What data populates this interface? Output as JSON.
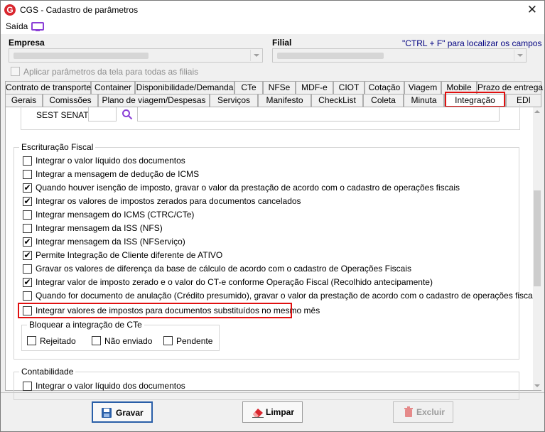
{
  "window": {
    "title": "CGS - Cadastro de parâmetros",
    "logo_letter": "G"
  },
  "menu": {
    "saida": "Saída"
  },
  "header": {
    "empresa_label": "Empresa",
    "filial_label": "Filial",
    "hint": "\"CTRL + F\" para localizar os campos",
    "apply_all": "Aplicar parâmetros da tela para todas as filiais"
  },
  "tabs_row1": [
    "Contrato de transporte",
    "Container",
    "Disponibilidade/Demanda",
    "CTe",
    "NFSe",
    "MDF-e",
    "CIOT",
    "Cotação",
    "Viagem",
    "Mobile",
    "Prazo de entrega"
  ],
  "tabs_row2": [
    "Gerais",
    "Comissões",
    "Plano de viagem/Despesas",
    "Serviços",
    "Manifesto",
    "CheckList",
    "Coleta",
    "Minuta",
    "Integração",
    "EDI"
  ],
  "sest": {
    "label": "SEST SENAT"
  },
  "escrituracao": {
    "title": "Escrituração Fiscal",
    "items": [
      {
        "label": "Integrar o valor líquido dos documentos",
        "checked": false
      },
      {
        "label": "Integrar a mensagem de dedução de ICMS",
        "checked": false
      },
      {
        "label": "Quando houver isenção de imposto, gravar o valor da prestação de acordo com o cadastro de operações fiscais",
        "checked": true
      },
      {
        "label": "Integrar os valores de impostos zerados para documentos cancelados",
        "checked": true
      },
      {
        "label": "Integrar mensagem do ICMS (CTRC/CTe)",
        "checked": false
      },
      {
        "label": "Integrar mensagem da ISS (NFS)",
        "checked": false
      },
      {
        "label": "Integrar mensagem da ISS (NFServiço)",
        "checked": true
      },
      {
        "label": "Permite Integração de Cliente diferente de ATIVO",
        "checked": true
      },
      {
        "label": "Gravar os valores de diferença da base de cálculo de acordo com o cadastro de Operações Fiscais",
        "checked": false
      },
      {
        "label": "Integrar valor de imposto zerado e o valor do CT-e conforme Operação Fiscal (Recolhido antecipamente)",
        "checked": true
      },
      {
        "label": "Quando for documento de anulação (Crédito presumido), gravar o valor da prestação de acordo com o cadastro de operações fiscais",
        "checked": false
      },
      {
        "label": "Integrar valores de impostos para documentos substituídos no mesmo mês",
        "checked": false
      }
    ]
  },
  "bloquear": {
    "title": "Bloquear a integração de CTe",
    "items": [
      {
        "label": "Rejeitado",
        "checked": false
      },
      {
        "label": "Não enviado",
        "checked": false
      },
      {
        "label": "Pendente",
        "checked": false
      }
    ]
  },
  "contabilidade": {
    "title": "Contabilidade",
    "items": [
      {
        "label": "Integrar o valor líquido dos documentos",
        "checked": false
      }
    ]
  },
  "buttons": {
    "gravar": "Gravar",
    "limpar": "Limpar",
    "excluir": "Excluir"
  },
  "colors": {
    "highlight": "#e01010",
    "primary_border": "#2a5fa8",
    "accent_purple": "#8b3fd6"
  }
}
